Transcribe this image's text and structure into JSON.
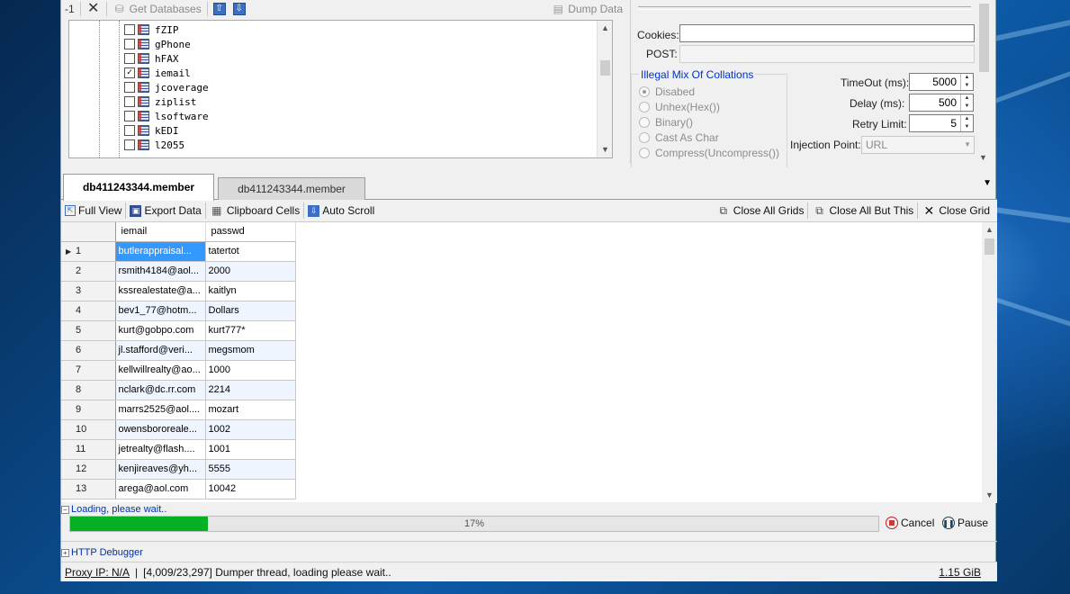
{
  "toolbar": {
    "minus_one": "-1",
    "get_databases": "Get Databases",
    "dump_data": "Dump Data"
  },
  "tree": {
    "items": [
      {
        "label": "fZIP",
        "checked": false
      },
      {
        "label": "gPhone",
        "checked": false
      },
      {
        "label": "hFAX",
        "checked": false
      },
      {
        "label": "iemail",
        "checked": true
      },
      {
        "label": "jcoverage",
        "checked": false
      },
      {
        "label": "ziplist",
        "checked": false
      },
      {
        "label": "lsoftware",
        "checked": false
      },
      {
        "label": "kEDI",
        "checked": false
      },
      {
        "label": "l2055",
        "checked": false
      }
    ]
  },
  "options": {
    "cookies_label": "Cookies:",
    "cookies_value": "",
    "post_label": "POST:",
    "post_value": "",
    "collations_title": "Illegal Mix Of Collations",
    "collations": [
      {
        "label": "Disabed",
        "selected": true
      },
      {
        "label": "Unhex(Hex())",
        "selected": false
      },
      {
        "label": "Binary()",
        "selected": false
      },
      {
        "label": "Cast As Char",
        "selected": false
      },
      {
        "label": "Compress(Uncompress())",
        "selected": false
      }
    ],
    "timeout_label": "TimeOut (ms):",
    "timeout_value": "5000",
    "delay_label": "Delay  (ms):",
    "delay_value": "500",
    "retry_label": "Retry Limit:",
    "retry_value": "5",
    "injection_label": "Injection Point:",
    "injection_value": "URL"
  },
  "tabs": [
    {
      "label": "db411243344.member",
      "active": true
    },
    {
      "label": "db411243344.member",
      "active": false
    }
  ],
  "grid_toolbar": {
    "full_view": "Full View",
    "export_data": "Export Data",
    "clipboard_cells": "Clipboard Cells",
    "auto_scroll": "Auto Scroll",
    "close_all_grids": "Close All Grids",
    "close_all_but_this": "Close All But This",
    "close_grid": "Close Grid"
  },
  "grid": {
    "columns": [
      "iemail",
      "passwd"
    ],
    "rows": [
      {
        "n": "1",
        "iemail": "butlerappraisal...",
        "passwd": "tatertot"
      },
      {
        "n": "2",
        "iemail": "rsmith4184@aol...",
        "passwd": "2000"
      },
      {
        "n": "3",
        "iemail": "kssrealestate@a...",
        "passwd": "kaitlyn"
      },
      {
        "n": "4",
        "iemail": "bev1_77@hotm...",
        "passwd": "Dollars"
      },
      {
        "n": "5",
        "iemail": "kurt@gobpo.com",
        "passwd": "kurt777*"
      },
      {
        "n": "6",
        "iemail": "jl.stafford@veri...",
        "passwd": "megsmom"
      },
      {
        "n": "7",
        "iemail": "kellwillrealty@ao...",
        "passwd": "1000"
      },
      {
        "n": "8",
        "iemail": "nclark@dc.rr.com",
        "passwd": "2214"
      },
      {
        "n": "9",
        "iemail": "marrs2525@aol....",
        "passwd": "mozart"
      },
      {
        "n": "10",
        "iemail": "owensbororeale...",
        "passwd": "1002"
      },
      {
        "n": "11",
        "iemail": "jetrealty@flash....",
        "passwd": "1001"
      },
      {
        "n": "12",
        "iemail": "kenjireaves@yh...",
        "passwd": "5555"
      },
      {
        "n": "13",
        "iemail": "arega@aol.com",
        "passwd": "10042"
      }
    ]
  },
  "loading": {
    "label": "Loading, please wait..",
    "progress_percent": 17,
    "progress_text": "17%",
    "cancel": "Cancel",
    "pause": "Pause"
  },
  "http_debugger": "HTTP Debugger",
  "status": {
    "proxy": "Proxy IP: N/A",
    "separator": "|",
    "message": "[4,009/23,297] Dumper thread, loading please wait..",
    "memory": "1.15 GiB"
  },
  "colors": {
    "progress_fill": "#06b025",
    "selection": "#3399ff",
    "link_blue": "#0033aa"
  }
}
